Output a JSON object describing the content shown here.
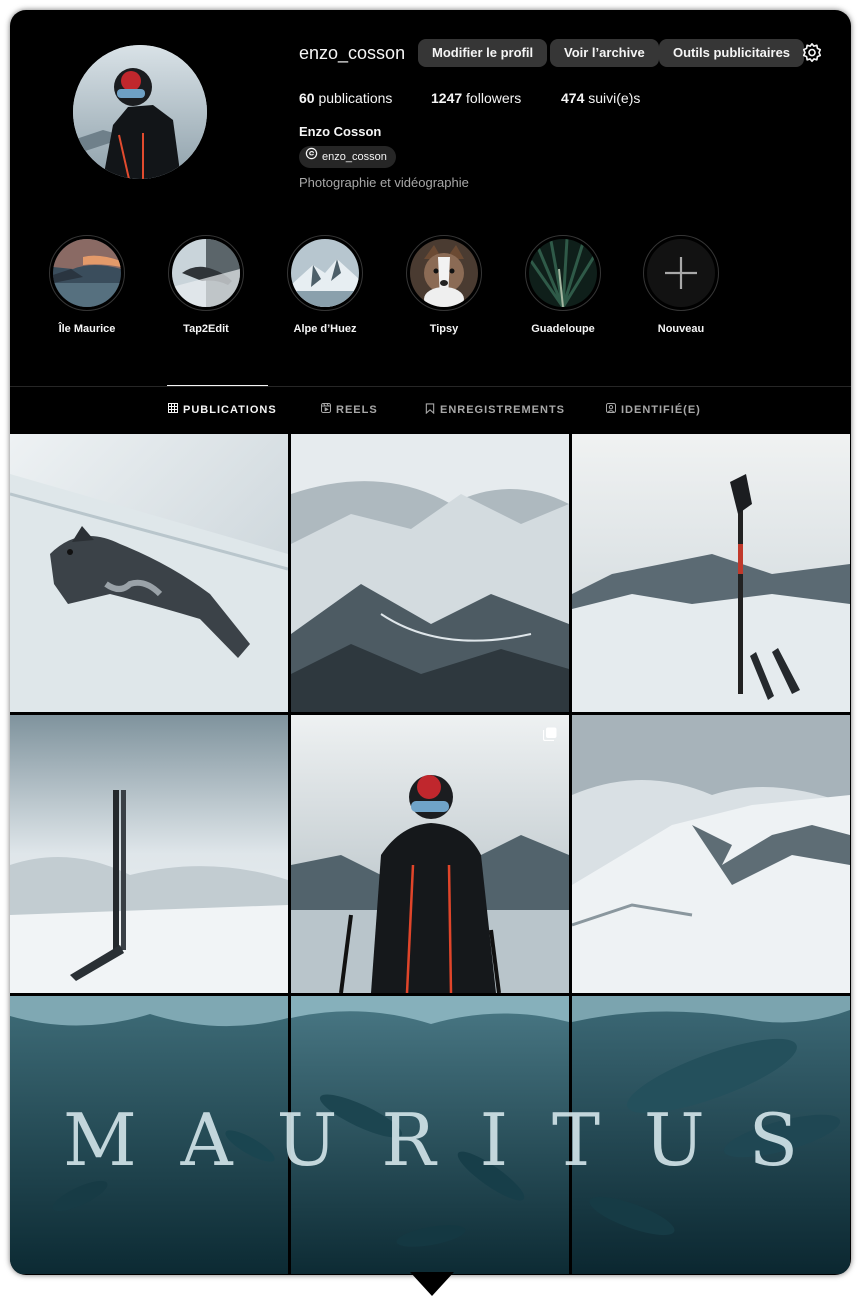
{
  "profile": {
    "username": "enzo_cosson",
    "full_name": "Enzo Cosson",
    "threads_handle": "enzo_cosson",
    "bio": "Photographie et vidéographie",
    "stats": {
      "posts_count": "60",
      "posts_label": "publications",
      "followers_count": "1247",
      "followers_label": "followers",
      "following_count": "474",
      "following_label": "suivi(e)s"
    }
  },
  "actions": {
    "edit_profile": "Modifier le profil",
    "view_archive": "Voir l’archive",
    "ad_tools": "Outils publicitaires"
  },
  "highlights": [
    {
      "label": "Île Maurice"
    },
    {
      "label": "Tap2Edit"
    },
    {
      "label": "Alpe d’Huez"
    },
    {
      "label": "Tipsy"
    },
    {
      "label": "Guadeloupe"
    },
    {
      "label": "Nouveau"
    }
  ],
  "tabs": [
    {
      "label": "PUBLICATIONS",
      "icon": "grid-icon",
      "active": true
    },
    {
      "label": "REELS",
      "icon": "reels-icon",
      "active": false
    },
    {
      "label": "ENREGISTREMENTS",
      "icon": "bookmark-icon",
      "active": false
    },
    {
      "label": "IDENTIFIÉ(E)",
      "icon": "tagged-icon",
      "active": false
    }
  ],
  "grid_overlay_text": "MAURITUS",
  "colors": {
    "background": "#000000",
    "button": "#363636",
    "text": "#f5f5f5",
    "muted": "#a8a8a8"
  }
}
